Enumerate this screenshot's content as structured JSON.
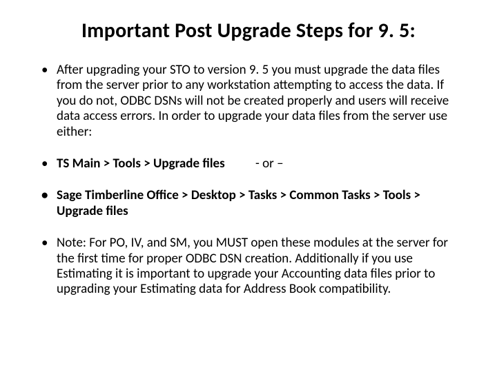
{
  "title": "Important Post Upgrade Steps for 9. 5:",
  "bullets": {
    "b1": "After upgrading your STO to version 9. 5 you must upgrade the data files from the server prior to any workstation attempting to access the data. If you do not, ODBC DSNs will not be created properly and users will receive data access errors. In order to upgrade your data files from the server use either:",
    "b2_path": "TS Main > Tools > Upgrade files",
    "b2_suffix": "- or –",
    "b3": "Sage Timberline Office > Desktop > Tasks > Common Tasks > Tools > Upgrade files",
    "b4": "Note: For PO, IV, and SM, you MUST open these modules at the server for the first time for proper ODBC DSN creation. Additionally if you use Estimating it is important to upgrade your Accounting data files prior to upgrading your Estimating data for Address Book compatibility."
  }
}
